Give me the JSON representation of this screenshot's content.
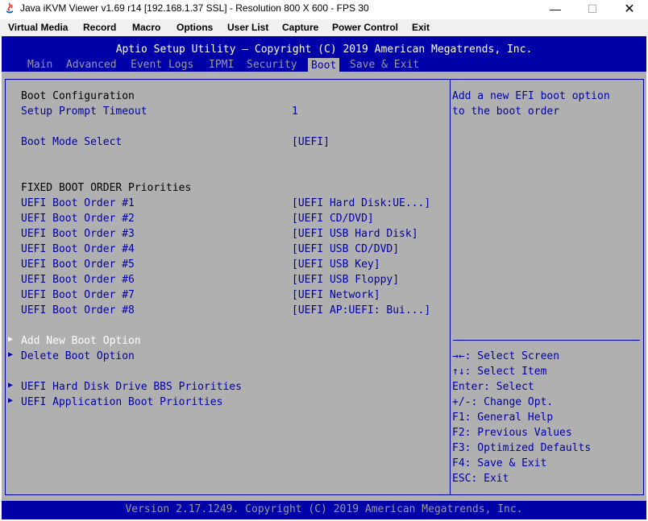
{
  "window": {
    "title": "Java iKVM Viewer v1.69 r14 [192.168.1.37 SSL]  - Resolution 800 X 600 - FPS 30",
    "minimize": "—",
    "maximize": "☐",
    "close": "✕"
  },
  "menu": [
    "Virtual Media",
    "Record",
    "Macro",
    "Options",
    "User List",
    "Capture",
    "Power Control",
    "Exit"
  ],
  "bios": {
    "header": "Aptio Setup Utility – Copyright (C) 2019 American Megatrends, Inc.",
    "tabs": [
      "Main",
      "Advanced",
      "Event Logs",
      "IPMI",
      "Security",
      "Boot",
      "Save & Exit"
    ],
    "active_tab": "Boot",
    "section_title": "Boot Configuration",
    "setup_prompt_label": "Setup Prompt Timeout",
    "setup_prompt_value": "1",
    "boot_mode_label": "Boot Mode Select",
    "boot_mode_value": "[UEFI]",
    "fixed_order_title": "FIXED BOOT ORDER Priorities",
    "boot_order": [
      {
        "label": "UEFI Boot Order #1",
        "value": "[UEFI Hard Disk:UE...]"
      },
      {
        "label": "UEFI Boot Order #2",
        "value": "[UEFI CD/DVD]"
      },
      {
        "label": "UEFI Boot Order #3",
        "value": "[UEFI USB Hard Disk]"
      },
      {
        "label": "UEFI Boot Order #4",
        "value": "[UEFI USB CD/DVD]"
      },
      {
        "label": "UEFI Boot Order #5",
        "value": "[UEFI USB Key]"
      },
      {
        "label": "UEFI Boot Order #6",
        "value": "[UEFI USB Floppy]"
      },
      {
        "label": "UEFI Boot Order #7",
        "value": "[UEFI Network]"
      },
      {
        "label": "UEFI Boot Order #8",
        "value": "[UEFI AP:UEFI: Bui...]"
      }
    ],
    "add_boot_option": "Add New Boot Option",
    "delete_boot_option": "Delete Boot Option",
    "hdd_bbs": "UEFI Hard Disk Drive BBS Priorities",
    "app_boot": "UEFI Application Boot Priorities",
    "help_text": [
      "Add a new EFI boot option",
      "to the boot order"
    ],
    "keys": [
      "→←: Select Screen",
      "↑↓: Select Item",
      "Enter: Select",
      "+/-: Change Opt.",
      "F1: General Help",
      "F2: Previous Values",
      "F3: Optimized Defaults",
      "F4: Save & Exit",
      "ESC: Exit"
    ],
    "footer": "Version 2.17.1249. Copyright (C) 2019 American Megatrends, Inc.",
    "colors": {
      "bg": "#b0b0b0",
      "blue": "#0000a8",
      "gray_text": "#9a9a9a",
      "white": "#ffffff"
    }
  }
}
